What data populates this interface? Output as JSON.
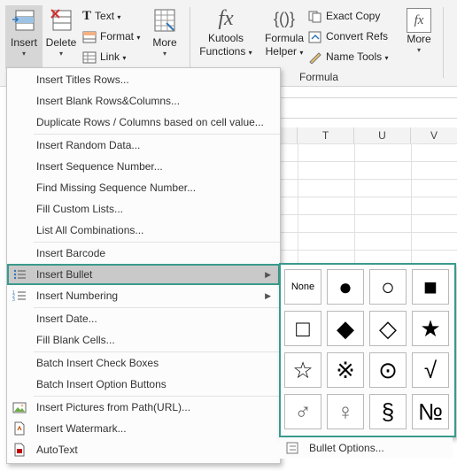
{
  "ribbon": {
    "insert_label": "Insert",
    "delete_label": "Delete",
    "text_label": "Text",
    "format_label": "Format",
    "link_label": "Link",
    "more_label": "More",
    "kutools_line1": "Kutools",
    "kutools_line2": "Functions",
    "fh_line1": "Formula",
    "fh_line2": "Helper",
    "exact_copy_label": "Exact Copy",
    "convert_refs_label": "Convert Refs",
    "name_tools_label": "Name Tools",
    "more2_label": "More",
    "formula_group_label": "Formula",
    "fx_glyph": "fx",
    "braces_glyph": "{()}",
    "dropdown_glyph": "▾"
  },
  "columns": [
    "T",
    "U",
    "V"
  ],
  "menu": {
    "items": [
      {
        "label": "Insert Titles Rows..."
      },
      {
        "label": "Insert Blank Rows&Columns..."
      },
      {
        "label": "Duplicate Rows / Columns based on cell value..."
      },
      {
        "label": "Insert Random Data..."
      },
      {
        "label": "Insert Sequence Number..."
      },
      {
        "label": "Find Missing Sequence Number..."
      },
      {
        "label": "Fill Custom Lists..."
      },
      {
        "label": "List All Combinations..."
      },
      {
        "label": "Insert Barcode"
      },
      {
        "label": "Insert Bullet"
      },
      {
        "label": "Insert Numbering"
      },
      {
        "label": "Insert Date..."
      },
      {
        "label": "Fill Blank Cells..."
      },
      {
        "label": "Batch Insert Check Boxes"
      },
      {
        "label": "Batch Insert Option Buttons"
      },
      {
        "label": "Insert Pictures from Path(URL)..."
      },
      {
        "label": "Insert Watermark..."
      },
      {
        "label": "AutoText"
      }
    ],
    "submenu_arrow": "▶"
  },
  "bullets": {
    "cells": [
      "None",
      "●",
      "○",
      "■",
      "□",
      "◆",
      "◇",
      "★",
      "☆",
      "※",
      "⊙",
      "√",
      "♂",
      "♀",
      "§",
      "№"
    ],
    "options_label": "Bullet Options..."
  }
}
